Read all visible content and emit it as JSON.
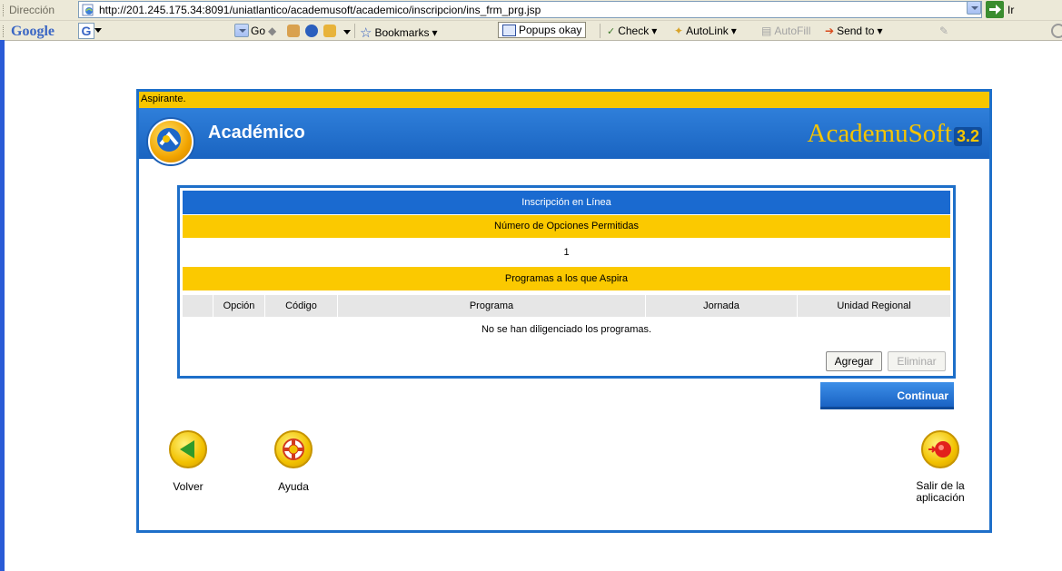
{
  "browser": {
    "address_label": "Dirección",
    "url": "http://201.245.175.34:8091/uniatlantico/academusoft/academico/inscripcion/ins_frm_prg.jsp",
    "go_label": "Ir"
  },
  "google_toolbar": {
    "logo": "Google",
    "g_button": "G",
    "go_label": "Go",
    "bookmarks_label": "Bookmarks",
    "popups_label": "Popups okay",
    "check_label": "Check",
    "autolink_label": "AutoLink",
    "autofill_label": "AutoFill",
    "sendto_label": "Send to"
  },
  "app": {
    "user_role": "Aspirante.",
    "section_title": "Académico",
    "brand_name": "AcademuSoft",
    "brand_version": "3.2"
  },
  "inscription": {
    "title": "Inscripción en Línea",
    "options_heading": "Número de Opciones Permitidas",
    "options_count": "1",
    "programs_heading": "Programas a los que Aspira",
    "columns": [
      "Opción",
      "Código",
      "Programa",
      "Jornada",
      "Unidad Regional"
    ],
    "empty_message": "No se han diligenciado los programas.",
    "add_button": "Agregar",
    "delete_button": "Eliminar"
  },
  "actions": {
    "continue_button": "Continuar",
    "back_label": "Volver",
    "help_label": "Ayuda",
    "exit_label_line1": "Salir de la",
    "exit_label_line2": "aplicación"
  },
  "colors": {
    "primary_blue": "#1e6fc9",
    "accent_yellow": "#fbc900"
  }
}
